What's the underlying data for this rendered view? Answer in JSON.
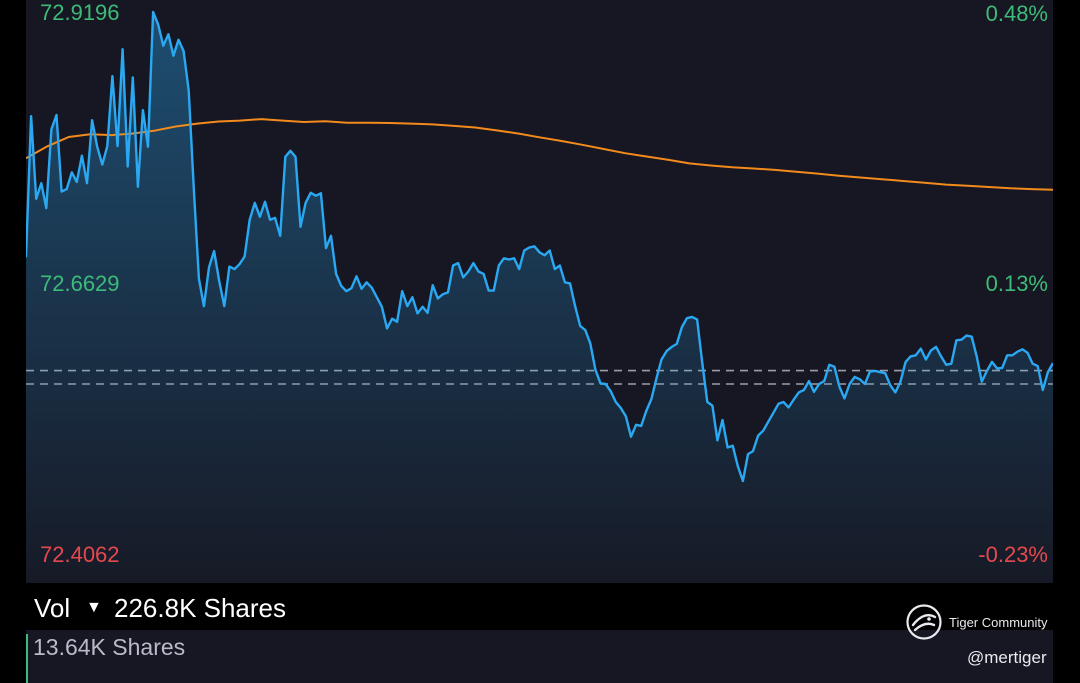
{
  "chart_data": {
    "type": "line",
    "ylim": [
      72.4062,
      72.9196
    ],
    "y_ticks": [
      "72.9196",
      "72.6629",
      "72.4062"
    ],
    "pct_ticks": [
      "0.48%",
      "0.13%",
      "-0.23%"
    ],
    "reference_lines": [
      72.5774,
      72.5646
    ],
    "series": [
      {
        "color": "#2aa8f2",
        "values": [
          72.6856,
          72.8202,
          72.7414,
          72.7562,
          72.7325,
          72.8077,
          72.8213,
          72.7482,
          72.7506,
          72.7666,
          72.7575,
          72.7825,
          72.7562,
          72.8163,
          72.7911,
          72.774,
          72.7917,
          72.8584,
          72.7917,
          72.8841,
          72.7723,
          72.8572,
          72.7529,
          72.8259,
          72.7911,
          72.9196,
          72.9076,
          72.8874,
          72.8984,
          72.8779,
          72.8931,
          72.8824,
          72.8447,
          72.7511,
          72.6652,
          72.6389,
          72.676,
          72.6915,
          72.6629,
          72.6389,
          72.6766,
          72.6743,
          72.6789,
          72.6863,
          72.7214,
          72.7374,
          72.7243,
          72.7386,
          72.7214,
          72.7231,
          72.706,
          72.7814,
          72.7871,
          72.7814,
          72.7146,
          72.7374,
          72.7471,
          72.7443,
          72.7466,
          72.6943,
          72.706,
          72.6697,
          72.6583,
          72.6532,
          72.656,
          72.6674,
          72.6555,
          72.6617,
          72.6566,
          72.6474,
          72.6383,
          72.6177,
          72.6269,
          72.624,
          72.6532,
          72.6389,
          72.6474,
          72.632,
          72.6383,
          72.6326,
          72.6589,
          72.6463,
          72.6503,
          72.652,
          72.6777,
          72.68,
          72.6663,
          72.672,
          72.68,
          72.672,
          72.6697,
          72.6537,
          72.6537,
          72.6777,
          72.6846,
          72.6834,
          72.6846,
          72.6743,
          72.692,
          72.6949,
          72.696,
          72.6903,
          72.6874,
          72.692,
          72.6743,
          72.6777,
          72.6617,
          72.6606,
          72.6389,
          72.62,
          72.616,
          72.6034,
          72.5783,
          72.5652,
          72.5646,
          72.5577,
          72.5474,
          72.5417,
          72.5337,
          72.5143,
          72.5257,
          72.5246,
          72.5389,
          72.5503,
          72.5697,
          72.588,
          72.596,
          72.6,
          72.6029,
          72.6189,
          72.6274,
          72.6286,
          72.6263,
          72.5852,
          72.5474,
          72.544,
          72.5109,
          72.5303,
          72.504,
          72.5057,
          72.4863,
          72.472,
          72.4977,
          72.5006,
          72.5154,
          72.52,
          72.5286,
          72.5371,
          72.5457,
          72.5474,
          72.5423,
          72.5497,
          72.5566,
          72.5589,
          72.5674,
          72.5571,
          72.5646,
          72.5674,
          72.5829,
          72.5811,
          72.5617,
          72.5509,
          72.5646,
          72.5714,
          72.5691,
          72.5646,
          72.5766,
          72.5771,
          72.576,
          72.5749,
          72.5634,
          72.5566,
          72.5669,
          72.5857,
          72.5909,
          72.592,
          72.5983,
          72.588,
          72.5966,
          72.6,
          72.5909,
          72.5829,
          72.584,
          72.6063,
          72.6069,
          72.6109,
          72.6097,
          72.5909,
          72.5669,
          72.5771,
          72.5857,
          72.5794,
          72.58,
          72.592,
          72.592,
          72.5954,
          72.5977,
          72.5943,
          72.584,
          72.5817,
          72.5589,
          72.576,
          72.5846
        ]
      },
      {
        "color": "#f28a1c",
        "values": [
          72.78,
          72.7914,
          72.8003,
          72.8029,
          72.8021,
          72.8037,
          72.8063,
          72.8103,
          72.8131,
          72.8151,
          72.816,
          72.8174,
          72.816,
          72.8146,
          72.8154,
          72.814,
          72.8139,
          72.8137,
          72.8131,
          72.8123,
          72.8109,
          72.8094,
          72.8066,
          72.8037,
          72.8,
          72.7966,
          72.7929,
          72.7889,
          72.7849,
          72.7817,
          72.7786,
          72.7751,
          72.7731,
          72.7714,
          72.7703,
          72.7689,
          72.7671,
          72.7654,
          72.7634,
          72.7617,
          72.76,
          72.7583,
          72.7566,
          72.7549,
          72.7537,
          72.7526,
          72.7514,
          72.7506,
          72.75
        ]
      }
    ]
  },
  "volume": {
    "label": "Vol",
    "caret": "▼",
    "value": "226.8K Shares",
    "sub_value": "13.64K Shares"
  },
  "brand": {
    "name": "Tiger Community",
    "handle": "@mertiger"
  },
  "colors": {
    "price_line": "#2aa8f2",
    "avg_line": "#f28a1c",
    "positive": "#3dbb78",
    "negative": "#e5484d",
    "panel_bg": "#161722"
  }
}
